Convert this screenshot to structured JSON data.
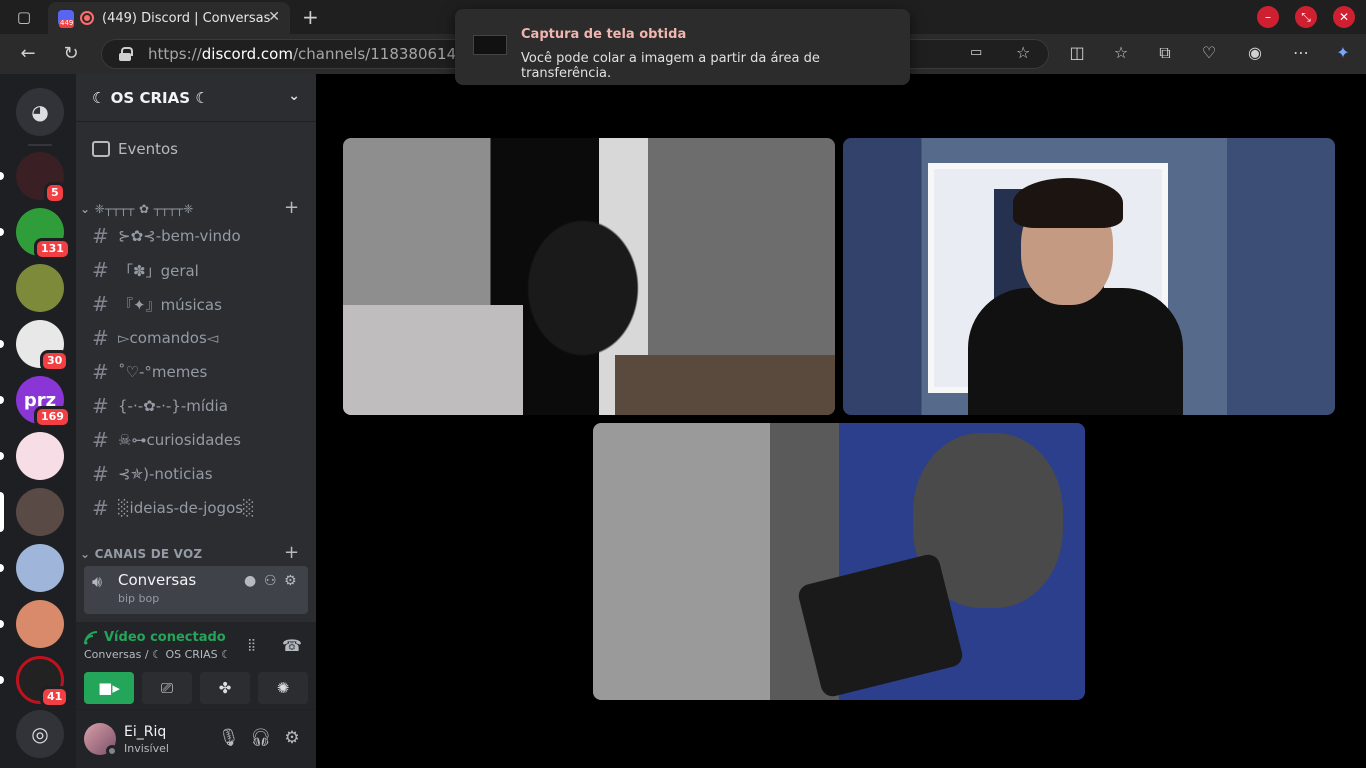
{
  "browser": {
    "tab_title": "(449) Discord | Conversas",
    "tab_badge": "449",
    "url_prefix": "https://",
    "url_domain": "discord.com",
    "url_path": "/channels/11838061413",
    "toast_title": "Captura de tela obtida",
    "toast_body": "Você pode colar a imagem a partir da área de transferência."
  },
  "guilds": [
    {
      "badge": "5",
      "color": "#3a1f24"
    },
    {
      "badge": "131",
      "color": "#2f9e3a"
    },
    {
      "badge": "",
      "color": "#7c8a3a"
    },
    {
      "badge": "30",
      "color": "#e8e8e8"
    },
    {
      "badge": "169",
      "color": "#8a35d6",
      "label": "prz"
    },
    {
      "badge": "",
      "color": "#f6dde6"
    },
    {
      "badge": "",
      "color": "#5a4a46"
    },
    {
      "badge": "",
      "color": "#9fb5d9"
    },
    {
      "badge": "",
      "color": "#d98a6a"
    },
    {
      "badge": "41",
      "color": "#222"
    }
  ],
  "server": {
    "name": "☾ OS CRIAS ☾",
    "events_label": "Eventos",
    "category_text": "❈┬┬┬┬ ✿ ┬┬┬┬❈",
    "text_channels": [
      "⊱✿⊰-bem-vindo",
      "「✽」geral",
      "『✦』músicas",
      "▻comandos◅",
      "˚♡-°memes",
      "{-·-✿-·-}-mídia",
      "☠⊶curiosidades",
      "⊰✯)-noticias",
      "░ideias-de-jogos░"
    ],
    "voice_category": "CANAIS DE VOZ",
    "voice_channel": {
      "name": "Conversas",
      "status": "bip bop"
    }
  },
  "rtc": {
    "status": "Vídeo conectado",
    "location": "Conversas / ☾ OS CRIAS ☾"
  },
  "user": {
    "name": "Ei_Riq",
    "status": "Invisível"
  }
}
